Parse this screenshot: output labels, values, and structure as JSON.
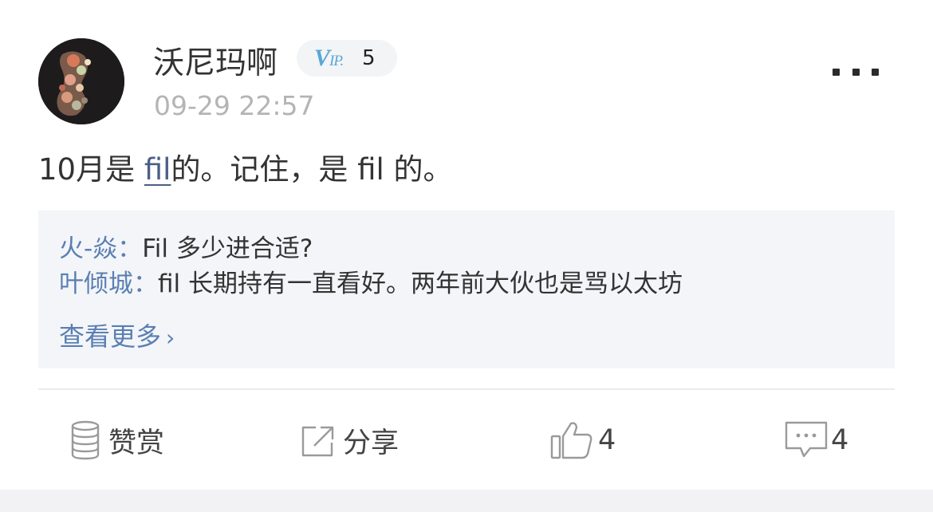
{
  "post": {
    "author": "沃尼玛啊",
    "vip": {
      "prefix": "V",
      "suffix": "IP.",
      "level": "5"
    },
    "timestamp": "09-29 22:57",
    "content": {
      "before": "10月是 ",
      "link": "fil",
      "after": "的。记住，是 fil 的。"
    }
  },
  "comments": [
    {
      "author": "火-焱：",
      "text": "Fil 多少进合适?"
    },
    {
      "author": "叶倾城：",
      "text": "fil 长期持有一直看好。两年前大伙也是骂以太坊"
    }
  ],
  "view_more": "查看更多",
  "actions": {
    "reward": "赞赏",
    "share": "分享",
    "likes": "4",
    "comments": "4"
  },
  "colors": {
    "link": "#5a7fb3",
    "vip": "#58a7d8",
    "timestamp": "#b4b4b4"
  }
}
